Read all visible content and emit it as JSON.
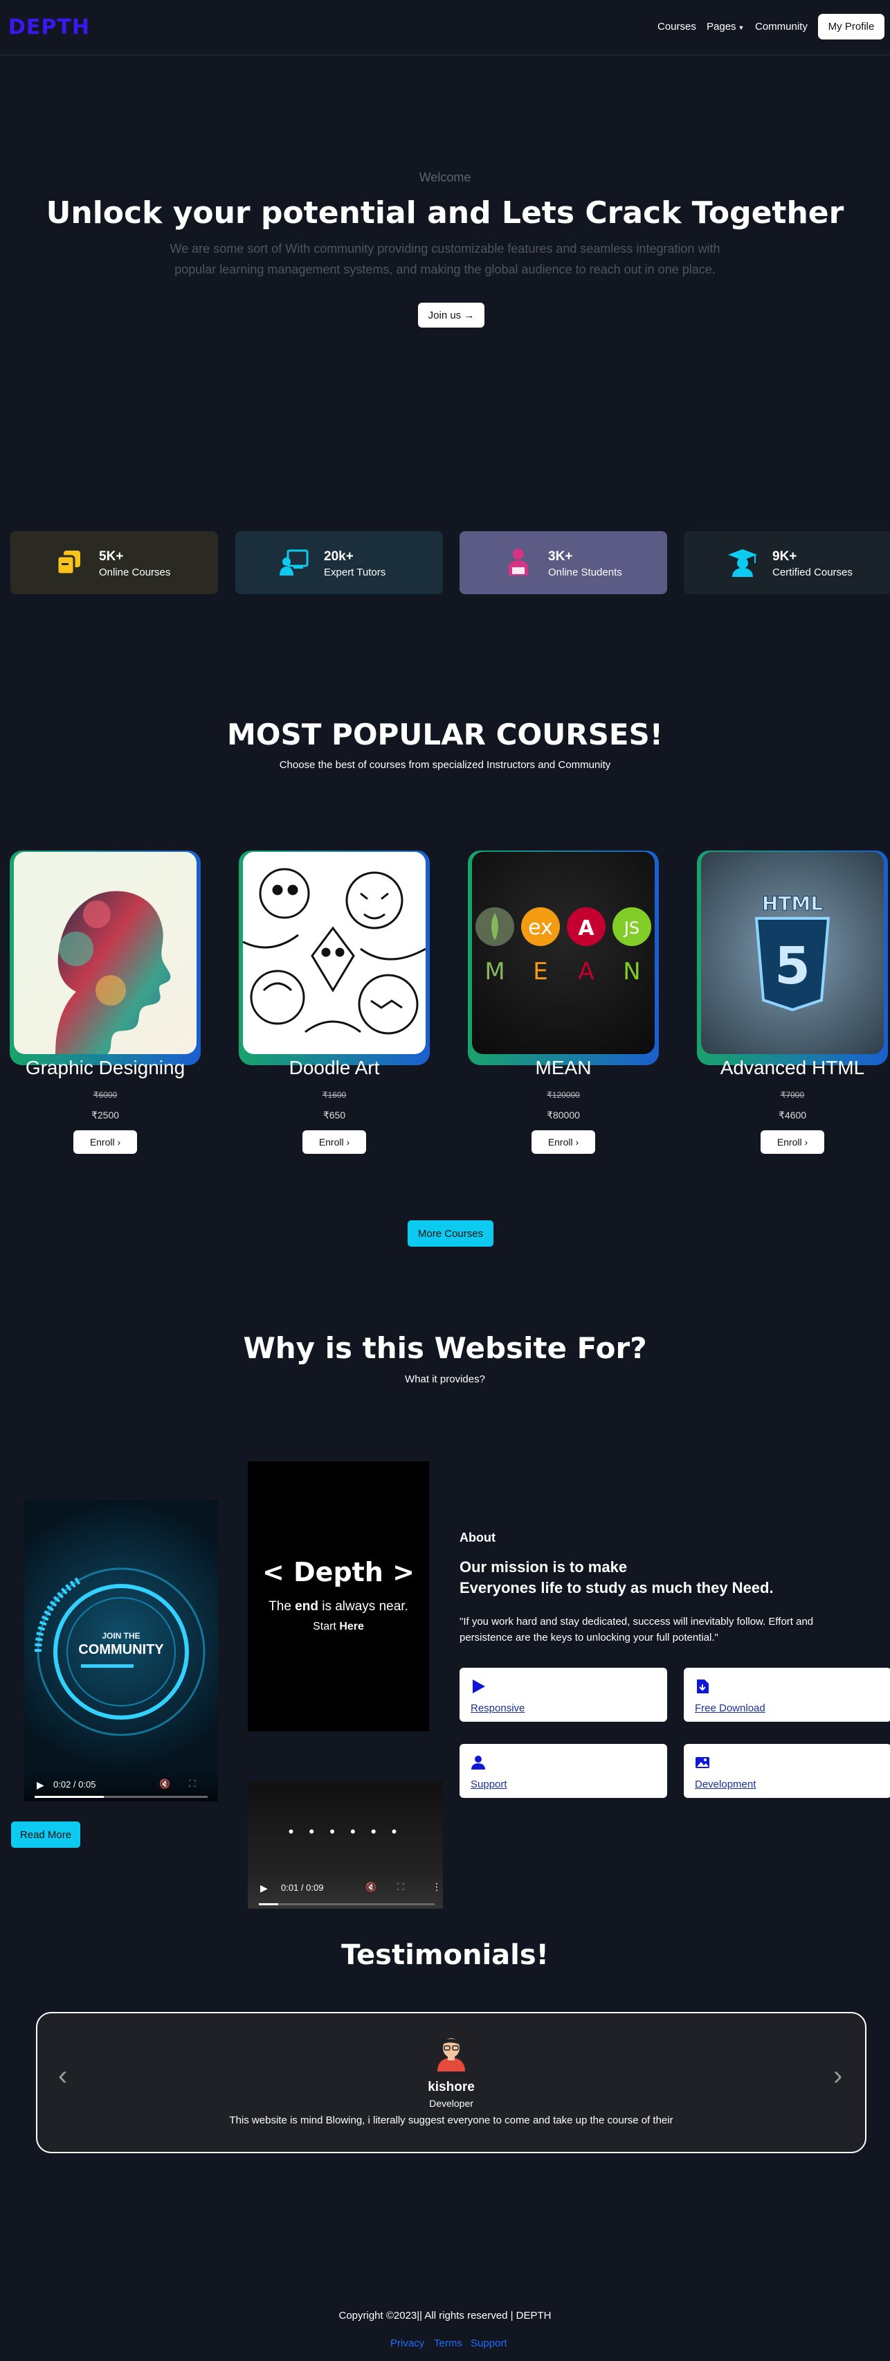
{
  "nav": {
    "logo": "DEPTH",
    "links": [
      "Courses",
      "Pages",
      "Community"
    ],
    "profile": "My Profile"
  },
  "hero": {
    "welcome": "Welcome",
    "title": "Unlock your potential and Lets Crack Together",
    "description": "We are some sort of With community providing customizable features and seamless integration with popular learning management systems, and making the global audience to reach out in one place.",
    "button": "Join us →"
  },
  "stats": [
    {
      "number": "5K+",
      "label": "Online Courses",
      "icon": "copy-icon",
      "color": "#f8c41b",
      "bg": "#2b2a22"
    },
    {
      "number": "20k+",
      "label": "Expert Tutors",
      "icon": "tutor-icon",
      "color": "#0dcaf0",
      "bg": "#1b2e3b"
    },
    {
      "number": "3K+",
      "label": "Online Students",
      "icon": "student-icon",
      "color": "#d63384",
      "bg": "#5b5b86"
    },
    {
      "number": "9K+",
      "label": "Certified Courses",
      "icon": "graduation-cap-icon",
      "color": "#0dcaf0",
      "bg": "#1a2329"
    }
  ],
  "popular": {
    "title": "MOST POPULAR COURSES!",
    "subtitle": "Choose the best of courses from specialized Instructors and Community",
    "courses": [
      {
        "name": "Graphic Designing",
        "old_price": "₹6000",
        "price": "₹2500",
        "enroll": "Enroll ›"
      },
      {
        "name": "Doodle Art",
        "old_price": "₹1600",
        "price": "₹650",
        "enroll": "Enroll ›"
      },
      {
        "name": "MEAN",
        "old_price": "₹120000",
        "price": "₹80000",
        "enroll": "Enroll ›"
      },
      {
        "name": "Advanced HTML",
        "old_price": "₹7000",
        "price": "₹4600",
        "enroll": "Enroll ›"
      }
    ],
    "more_button": "More Courses",
    "mean_letters": [
      "M",
      "E",
      "A",
      "N"
    ],
    "html_logo_text": "HTML",
    "html_logo_number": "5"
  },
  "why": {
    "title": "Why is this Website For?",
    "subtitle": "What it provides?",
    "video1": {
      "line1": "JOIN THE",
      "line2": "COMMUNITY",
      "time": "0:02 / 0:05",
      "progress": 0.4
    },
    "video2": {
      "brand": "Depth",
      "tagline_pre": "The",
      "tagline_bold": "end",
      "tagline_post": "is always near.",
      "start_pre": "Start",
      "start_bold": "Here"
    },
    "video3": {
      "time": "0:01 / 0:09",
      "progress": 0.11
    },
    "about_label": "About",
    "mission": "Our mission is to make",
    "mission2": "Everyones life to study as much they Need.",
    "quote": "\"If you work hard and stay dedicated, success will inevitably follow. Effort and persistence are the keys to unlocking your full potential.\"",
    "features": [
      {
        "label": "Responsive",
        "icon": "play-icon"
      },
      {
        "label": "Free Download",
        "icon": "file-download-icon"
      },
      {
        "label": "Support",
        "icon": "person-icon"
      },
      {
        "label": "Development",
        "icon": "image-icon"
      }
    ],
    "read_more": "Read More"
  },
  "testimonials": {
    "title": "Testimonials!",
    "name": "kishore",
    "role": "Developer",
    "text": "This website is mind Blowing, i literally suggest everyone to come and take up the course of their"
  },
  "footer": {
    "copyright": "Copyright ©2023|| All rights reserved | DEPTH",
    "links": [
      "Privacy",
      "Terms",
      "Support"
    ]
  }
}
